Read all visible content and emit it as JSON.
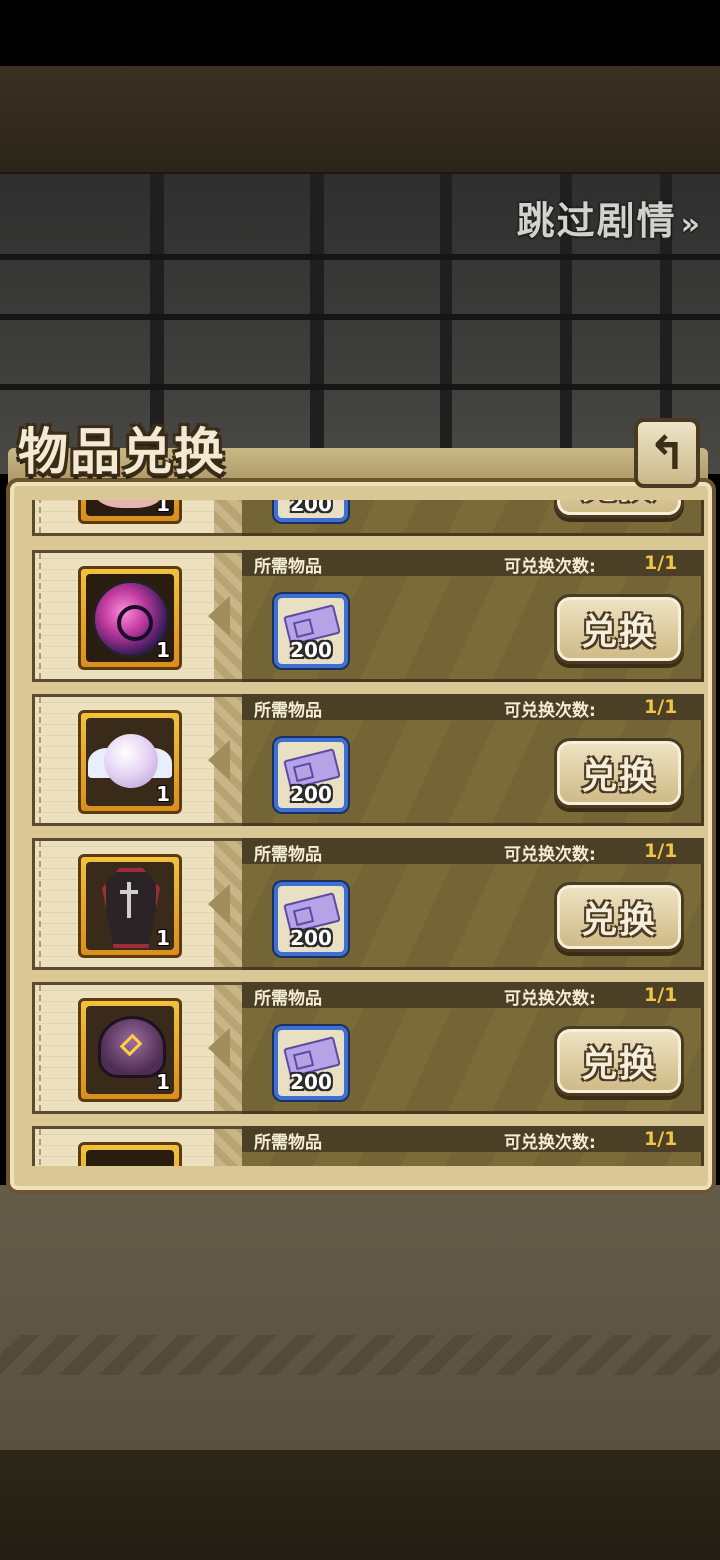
{
  "skip_label": "跳过剧情",
  "skip_arrows": "»",
  "panel_title": "物品兑换",
  "back_icon": "↰",
  "labels": {
    "required_items": "所需物品",
    "exchange_count": "可兑换次数:",
    "exchange_button": "兑换"
  },
  "rows": [
    {
      "item": "partial-item-icon",
      "qty": "1",
      "cost": "200",
      "count": ""
    },
    {
      "item": "orb-icon",
      "qty": "1",
      "cost": "200",
      "count": "1/1"
    },
    {
      "item": "pearl-icon",
      "qty": "1",
      "cost": "200",
      "count": "1/1"
    },
    {
      "item": "coffin-icon",
      "qty": "1",
      "cost": "200",
      "count": "1/1"
    },
    {
      "item": "helmet-icon",
      "qty": "1",
      "cost": "200",
      "count": "1/1"
    },
    {
      "item": "partial-item-icon",
      "qty": "",
      "cost": "",
      "count": "1/1"
    }
  ],
  "colors": {
    "count_value": "#f1c645",
    "cost_border": "#3f6fd0",
    "reward_frame": "#f1c23b"
  }
}
